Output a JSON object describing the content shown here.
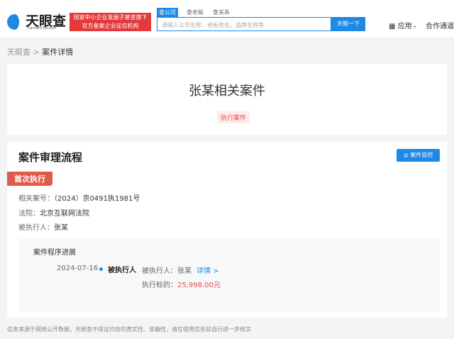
{
  "header": {
    "logo": "天眼查",
    "logo_sub": "TianYanCha.com",
    "badge_line1": "国家中小企业发展子基金旗下",
    "badge_line2": "官方备案企业征信机构",
    "tabs": [
      "查公司",
      "查老板",
      "查关系"
    ],
    "search_placeholder": "请输入公司名称、老板姓名、品牌名称等",
    "search_button": "天眼一下",
    "apps": "应用",
    "partner": "合作通道"
  },
  "breadcrumb": {
    "home": "天眼查",
    "sep": ">",
    "current": "案件详情"
  },
  "case": {
    "title": "张某相关案件",
    "tag": "执行案件"
  },
  "flow": {
    "title": "案件审理流程",
    "monitor_button": "案件监控",
    "stage": "首次执行",
    "rows": [
      {
        "label": "相关案号：",
        "value": "（2024）京0491执1981号"
      },
      {
        "label": "法院：",
        "value": "北京互联网法院"
      },
      {
        "label": "被执行人：",
        "value": "张某"
      }
    ],
    "progress": {
      "title": "案件程序进展",
      "date": "2024-07-16",
      "role": "被执行人",
      "party": "被执行人：张某",
      "detail": "详情 >",
      "amount_label": "执行标的：",
      "amount": "25,998.00元"
    }
  },
  "footer": "信息来源于网络公开数据，天眼查不保证内容的真实性、准确性，请在使用信息前自行进一步核实",
  "colors": {
    "brand": "#1e88e5",
    "red": "#e0514a"
  }
}
